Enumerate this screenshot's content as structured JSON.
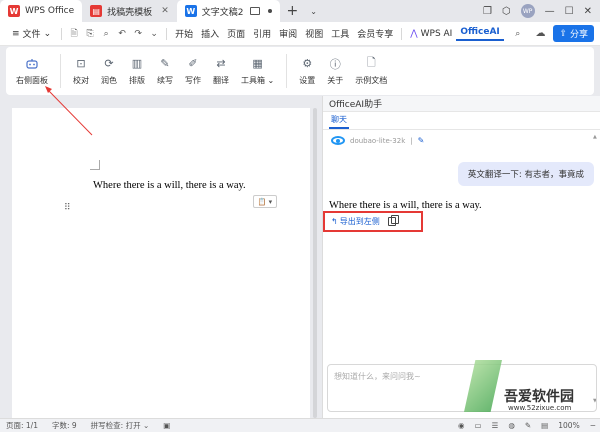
{
  "titlebar": {
    "tabs": [
      {
        "label": "WPS Office",
        "icon": "wps-logo-icon",
        "color": "#e53935",
        "active": true
      },
      {
        "label": "找稿壳模板",
        "icon": "template-icon",
        "color": "#e53935",
        "active": false
      },
      {
        "label": "文字文稿2",
        "icon": "word-doc-icon",
        "color": "#1a73e8",
        "active": true
      }
    ],
    "avatar_text": "WP"
  },
  "menubar": {
    "file_label": "文件",
    "items": [
      "开始",
      "插入",
      "页面",
      "引用",
      "审阅",
      "视图",
      "工具",
      "会员专享"
    ],
    "wps_ai_label": "WPS AI",
    "officeai_label": "OfficeAI",
    "share_label": "分享"
  },
  "ribbon": {
    "group1": [
      {
        "label": "右侧面板",
        "icon": "robot-icon"
      }
    ],
    "group2": [
      {
        "label": "校对",
        "icon": "proofread-icon"
      },
      {
        "label": "润色",
        "icon": "polish-icon"
      },
      {
        "label": "排版",
        "icon": "layout-icon"
      },
      {
        "label": "续写",
        "icon": "continue-write-icon"
      },
      {
        "label": "写作",
        "icon": "write-icon"
      },
      {
        "label": "翻译",
        "icon": "translate-icon"
      },
      {
        "label": "工具箱",
        "icon": "toolbox-icon"
      }
    ],
    "group3": [
      {
        "label": "设置",
        "icon": "settings-icon"
      },
      {
        "label": "关于",
        "icon": "info-icon"
      },
      {
        "label": "示例文档",
        "icon": "sample-doc-icon"
      }
    ]
  },
  "document": {
    "text": "Where there is a will, there is a way."
  },
  "assistant": {
    "title": "OfficeAI助手",
    "tab": "聊天",
    "model": "doubao-lite-32k",
    "model_suffix": "|",
    "user_message": "英文翻译一下: 有志者，事竟成",
    "ai_reply": "Where there is a will, there is a way.",
    "export_label": "导出到左侧",
    "input_placeholder": "想知道什么，来问问我~"
  },
  "watermark": {
    "line1": "吾爱软件园",
    "line2": "www.52zixue.com"
  },
  "statusbar": {
    "page": "页面: 1/1",
    "words": "字数: 9",
    "spellcheck": "拼写检查: 打开",
    "zoom": "100%"
  },
  "colors": {
    "accent": "#1a5fd0",
    "annotation_red": "#e53935"
  }
}
